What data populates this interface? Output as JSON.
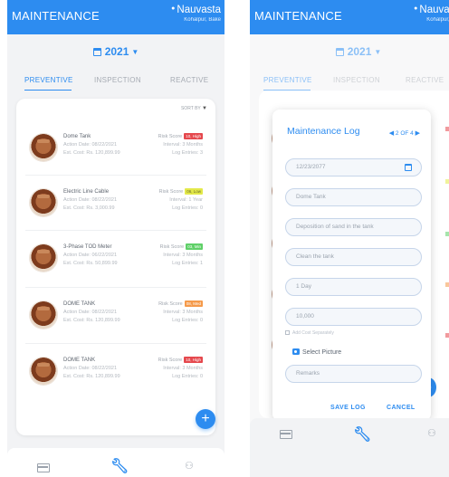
{
  "left": {
    "header": {
      "title": "MAINTENANCE",
      "location": "Nauvasta",
      "location_sub": "Kohalpur, Bake"
    },
    "year": "2021",
    "tabs": [
      "PREVENTIVE",
      "INSPECTION",
      "REACTIVE"
    ],
    "sort_label": "SORT BY",
    "items": [
      {
        "name": "Dome Tank",
        "action_date": "Action Date: 08/22/2021",
        "est_cost": "Est. Cost: Rs. 120,899.99",
        "risk_label": "Risk Score",
        "risk": "10, High",
        "risk_color": "#e5484d",
        "interval": "Interval: 3 Months",
        "log_entries": "Log Entries: 3"
      },
      {
        "name": "Electric Line Cable",
        "action_date": "Action Date: 08/22/2021",
        "est_cost": "Est. Cost: Rs. 3,000.99",
        "risk_label": "Risk Score",
        "risk": "06, Low",
        "risk_color": "#e3e94a",
        "interval": "Interval: 1 Year",
        "log_entries": "Log Entries: 0"
      },
      {
        "name": "3-Phase TOD Meter",
        "action_date": "Action Date: 06/22/2021",
        "est_cost": "Est. Cost: Rs. 50,899.99",
        "risk_label": "Risk Score",
        "risk": "03, Min",
        "risk_color": "#5fd068",
        "interval": "Interval: 3 Months",
        "log_entries": "Log Entries: 1"
      },
      {
        "name": "DOME TANK",
        "action_date": "Action Date: 08/22/2021",
        "est_cost": "Est. Cost: Rs. 120,899.99",
        "risk_label": "Risk Score",
        "risk": "08, Med",
        "risk_color": "#f59a4a",
        "interval": "Interval: 3 Months",
        "log_entries": "Log Entries: 0"
      },
      {
        "name": "DOME TANK",
        "action_date": "Action Date: 08/22/2021",
        "est_cost": "Est. Cost: Rs. 120,899.99",
        "risk_label": "Risk Score",
        "risk": "10, High",
        "risk_color": "#e5484d",
        "interval": "Interval: 3 Months",
        "log_entries": "Log Entries: 0"
      }
    ],
    "fab": "+"
  },
  "right": {
    "header": {
      "title": "MAINTENANCE",
      "location": "Nauvasta",
      "location_sub": "Kohalpur, Bake"
    },
    "year": "2021",
    "tabs": [
      "PREVENTIVE",
      "INSPECTION",
      "REACTIVE"
    ],
    "modal": {
      "title": "Maintenance Log",
      "pager": "2 OF 4",
      "date": "12/23/2077",
      "asset": "Dome Tank",
      "issue": "Deposition of sand in the tank",
      "task": "Clean the tank",
      "duration": "1 Day",
      "cost": "10,000",
      "checkbox_label": "Add Cost Separately",
      "select_picture": "Select Picture",
      "remarks_placeholder": "Remarks",
      "save_label": "SAVE LOG",
      "cancel_label": "CANCEL"
    }
  },
  "colors": {
    "primary": "#2d8cf0",
    "background": "#f2f3f5"
  }
}
